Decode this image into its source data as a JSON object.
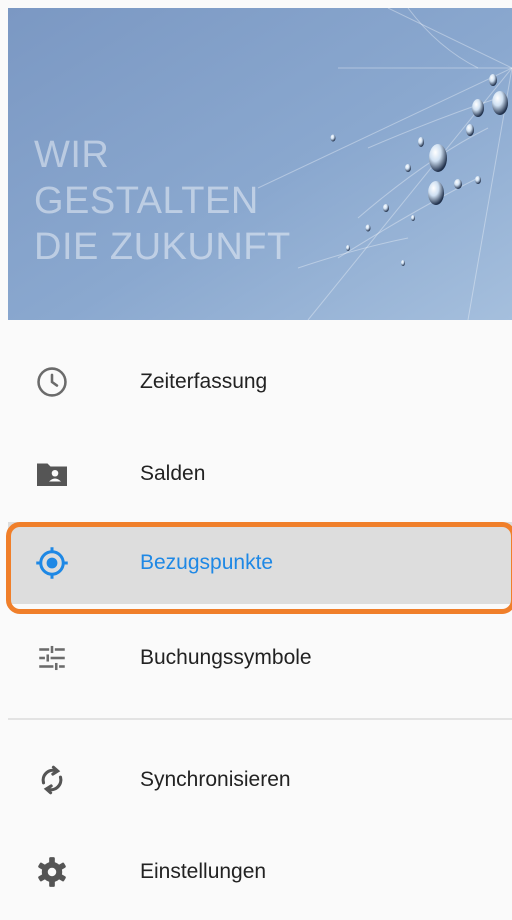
{
  "header": {
    "slogan_lines": [
      "WIR",
      "GESTALTEN",
      "DIE ZUKUNFT"
    ]
  },
  "menu": {
    "items": [
      {
        "label": "Zeiterfassung",
        "icon": "clock-icon",
        "active": false
      },
      {
        "label": "Salden",
        "icon": "folder-account-icon",
        "active": false
      },
      {
        "label": "Bezugspunkte",
        "icon": "crosshair-location-icon",
        "active": true
      },
      {
        "label": "Buchungssymbole",
        "icon": "tune-sliders-icon",
        "active": false
      }
    ],
    "secondary": [
      {
        "label": "Synchronisieren",
        "icon": "sync-icon"
      },
      {
        "label": "Einstellungen",
        "icon": "gear-icon"
      }
    ]
  },
  "colors": {
    "active_text": "#1e88e5",
    "active_bg": "#dddddd",
    "highlight_border": "#f07f2a",
    "icon_gray": "#6b6b6b"
  }
}
